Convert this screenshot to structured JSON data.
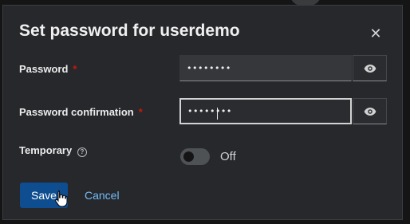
{
  "dialog": {
    "title": "Set password for userdemo",
    "close_icon": "close-icon"
  },
  "fields": {
    "password": {
      "label": "Password",
      "required_marker": "*",
      "value": "••••••••",
      "toggle_icon": "eye-icon"
    },
    "password_confirmation": {
      "label": "Password confirmation",
      "required_marker": "*",
      "value": "••••••••",
      "focused": true,
      "toggle_icon": "eye-icon"
    },
    "temporary": {
      "label": "Temporary",
      "help_icon": "question-circle-icon",
      "switch_on": false,
      "switch_state_label": "Off"
    }
  },
  "actions": {
    "save_label": "Save",
    "cancel_label": "Cancel"
  },
  "colors": {
    "dialog_background": "#26282c",
    "primary_button": "#0e4d8f",
    "link": "#73bcf7",
    "required": "#c9190b"
  }
}
